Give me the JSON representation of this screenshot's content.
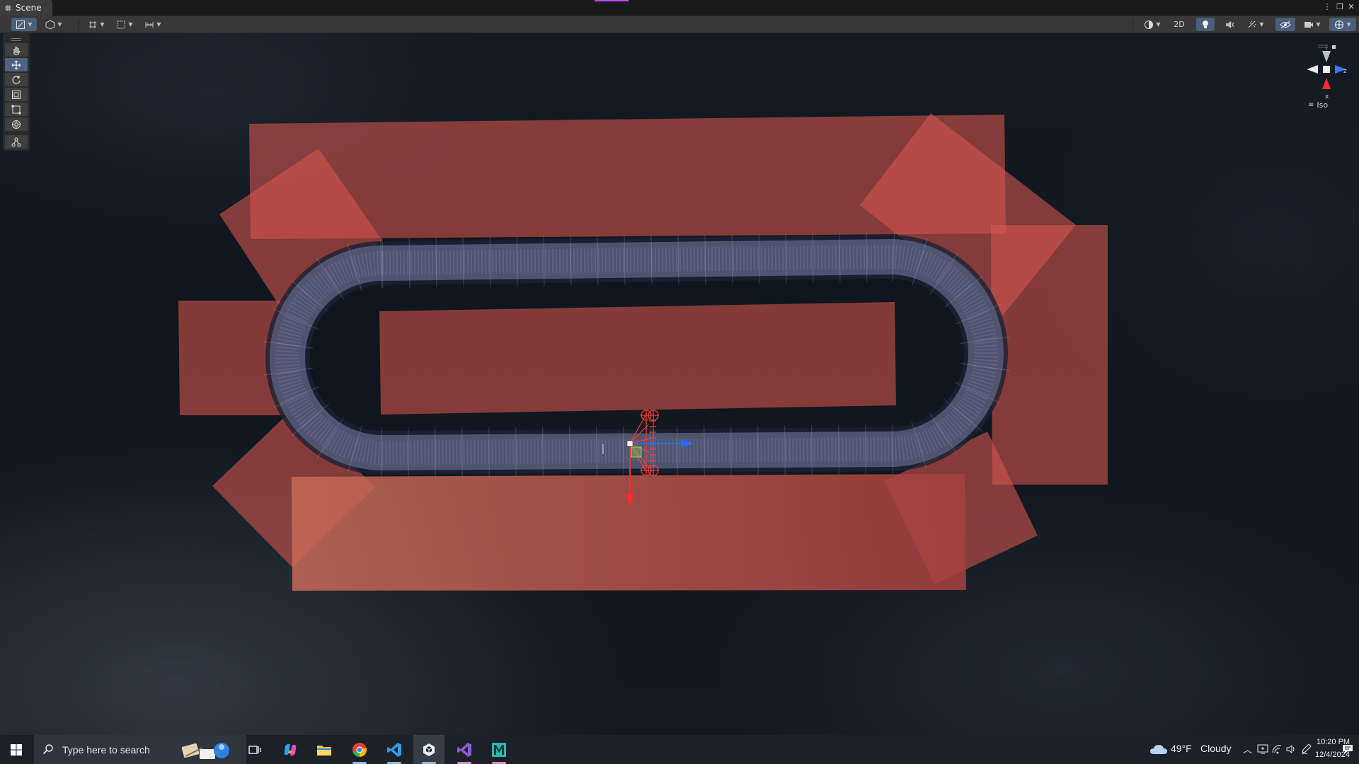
{
  "window": {
    "tab_label": "Scene"
  },
  "toolbar": {
    "left_icons": [
      "draw-mode-icon",
      "shading-icon",
      "snap-icon",
      "grid-icon",
      "increment-snap-icon"
    ],
    "mode_2d_label": "2D",
    "right_icons": [
      "render-mode-icon",
      "lighting-icon",
      "audio-icon",
      "effects-icon",
      "scene-visibility-icon",
      "camera-icon",
      "gizmos-icon"
    ]
  },
  "tools": {
    "items": [
      "hand-tool",
      "move-tool",
      "rotate-tool",
      "scale-tool",
      "rect-tool",
      "transform-tool",
      "custom-tool"
    ],
    "active": "move-tool"
  },
  "gizmo": {
    "projection_label": "Iso",
    "axis_labels": {
      "x": "x",
      "z": "z"
    }
  },
  "colors": {
    "collider_fill": "#d8574f",
    "track": "#545a77",
    "axis_x": "#ff2a2a",
    "axis_z": "#2a6bff",
    "axis_y": "#7fe04c"
  },
  "taskbar": {
    "search_placeholder": "Type here to search",
    "apps": [
      "task-view-icon",
      "copilot-icon",
      "file-explorer-icon",
      "chrome-icon",
      "vscode-icon",
      "unity-icon",
      "visual-studio-icon",
      "maya-icon"
    ],
    "weather": {
      "temp": "49°F",
      "condition": "Cloudy"
    },
    "time": "10:20 PM",
    "date": "12/4/2024"
  }
}
